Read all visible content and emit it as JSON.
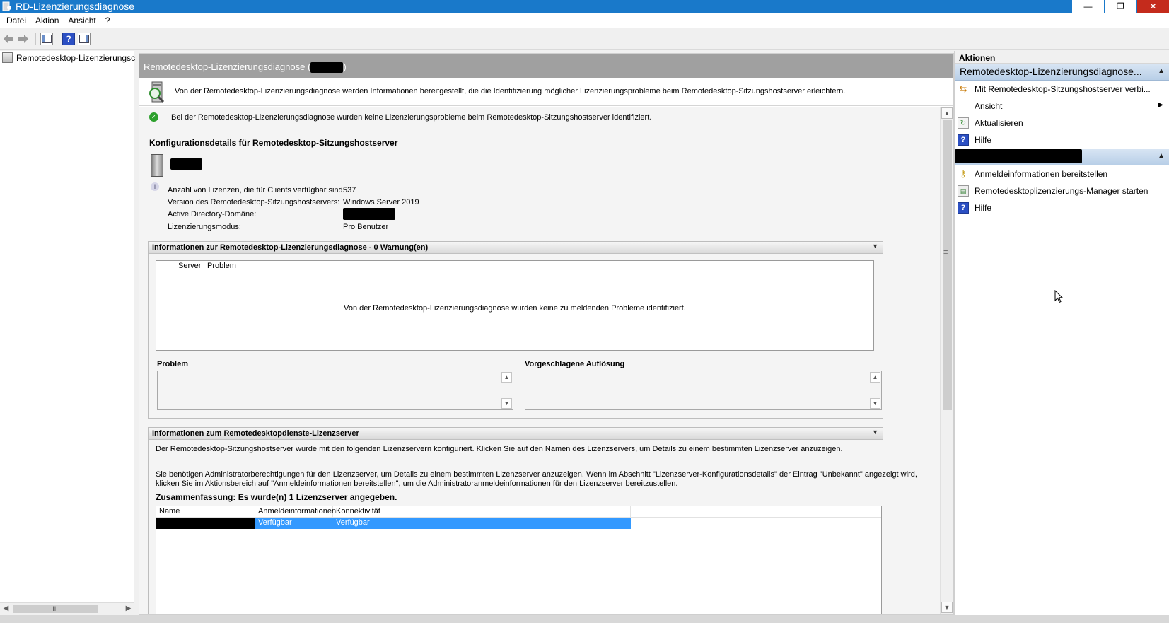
{
  "window": {
    "title": "RD-Lizenzierungsdiagnose",
    "controls": {
      "minimize": "—",
      "maximize": "❐",
      "close": "✕"
    }
  },
  "menu": [
    "Datei",
    "Aktion",
    "Ansicht",
    "?"
  ],
  "toolbar": {
    "icons": [
      "back-arrow-icon",
      "forward-arrow-icon",
      "show-hide-console-tree-icon",
      "help-icon",
      "show-hide-action-pane-icon"
    ],
    "help_glyph": "?"
  },
  "tree": {
    "item_label": "Remotedesktop-Lizenzierungsc",
    "scroll_grip": "III"
  },
  "header": {
    "title_prefix": "Remotedesktop-Lizenzierungsdiagnose (",
    "title_suffix": ")"
  },
  "intro": {
    "text": "Von der Remotedesktop-Lizenzierungsdiagnose werden Informationen bereitgestellt, die die Identifizierung möglicher Lizenzierungsprobleme beim Remotedesktop-Sitzungshostserver erleichtern."
  },
  "status": {
    "text": "Bei der Remotedesktop-Lizenzierungsdiagnose wurden keine Lizenzierungsprobleme beim Remotedesktop-Sitzungshostserver identifiziert.",
    "color": "#2ca02c"
  },
  "config": {
    "heading": "Konfigurationsdetails für Remotedesktop-Sitzungshostserver",
    "rows": [
      {
        "label": "Anzahl von Lizenzen, die für Clients verfügbar sind:",
        "value": "537"
      },
      {
        "label": "Version des Remotedesktop-Sitzungshostservers:",
        "value": "Windows Server 2019"
      },
      {
        "label": "Active Directory-Domäne:",
        "value": ""
      },
      {
        "label": "Lizenzierungsmodus:",
        "value": "Pro Benutzer"
      }
    ]
  },
  "diagnostics": {
    "heading": "Informationen zur Remotedesktop-Lizenzierungsdiagnose - 0 Warnung(en)",
    "columns": [
      "",
      "Server",
      "Problem"
    ],
    "empty_message": "Von der Remotedesktop-Lizenzierungsdiagnose wurden keine zu meldenden Probleme identifiziert.",
    "problem_label": "Problem",
    "resolution_label": "Vorgeschlagene Auflösung"
  },
  "license_servers": {
    "heading": "Informationen zum Remotedesktopdienste-Lizenzserver",
    "paragraph1": "Der Remotedesktop-Sitzungshostserver wurde mit den folgenden Lizenzservern konfiguriert. Klicken Sie auf den Namen des Lizenzservers, um Details zu einem bestimmten Lizenzserver anzuzeigen.",
    "paragraph2_line1": "Sie benötigen Administratorberechtigungen für den Lizenzserver, um Details zu einem bestimmten Lizenzserver anzuzeigen. Wenn im Abschnitt \"Lizenzserver-Konfigurationsdetails\" der Eintrag \"Unbekannt\" angezeigt wird,",
    "paragraph2_line2": "klicken Sie im Aktionsbereich auf \"Anmeldeinformationen bereitstellen\", um die Administratoranmeldeinformationen für den Lizenzserver bereitzustellen.",
    "summary": "Zusammenfassung: Es wurde(n) 1 Lizenzserver angegeben.",
    "columns": [
      "Name",
      "Anmeldeinformationen",
      "Konnektivität"
    ],
    "rows": [
      {
        "name": "",
        "credentials": "Verfügbar",
        "connectivity": "Verfügbar"
      }
    ],
    "selected_color": "#3399ff"
  },
  "actions": {
    "heading": "Aktionen",
    "group1": {
      "title": "Remotedesktop-Lizenzierungsdiagnose...",
      "items": [
        {
          "label": "Mit Remotedesktop-Sitzungshostserver verbi...",
          "icon": "connect-icon"
        },
        {
          "label": "Ansicht",
          "icon": "",
          "submenu": "▶"
        },
        {
          "label": "Aktualisieren",
          "icon": "refresh-icon"
        },
        {
          "label": "Hilfe",
          "icon": "help-icon"
        }
      ]
    },
    "group2": {
      "title": "",
      "items": [
        {
          "label": "Anmeldeinformationen bereitstellen",
          "icon": "key-icon"
        },
        {
          "label": "Remotedesktoplizenzierungs-Manager starten",
          "icon": "license-manager-icon"
        },
        {
          "label": "Hilfe",
          "icon": "help-icon"
        }
      ]
    }
  },
  "accent_color": "#1979ca"
}
